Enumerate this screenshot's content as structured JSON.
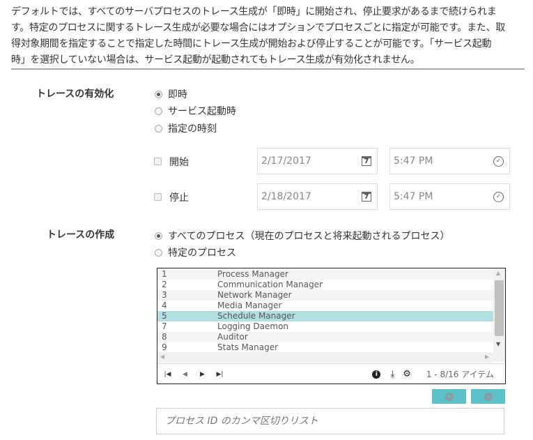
{
  "description_lines": [
    "デフォルトでは、すべてのサーバプロセスのトレース生成が「即時」に開始され、停止要求があるまで続けられま",
    "す。特定のプロセスに関するトレース生成が必要な場合にはオプションでプロセスごとに指定が可能です。また、取",
    "得対象期間を指定することで指定した時間にトレース生成が開始および停止することが可能です。「サービス起動",
    "時」を選択していない場合は、サービス起動が起動されてもトレース生成が有効化されません。"
  ],
  "enable": {
    "label": "トレースの有効化",
    "options": [
      "即時",
      "サービス起動時",
      "指定の時刻"
    ],
    "selected": 0
  },
  "start": {
    "label": "開始",
    "checked": false,
    "date": "2/17/2017",
    "time": "5:47 PM"
  },
  "stop": {
    "label": "停止",
    "checked": false,
    "date": "2/18/2017",
    "time": "5:47 PM"
  },
  "create": {
    "label": "トレースの作成",
    "options": [
      "すべてのプロセス（現在のプロセスと将来起動されるプロセス）",
      "特定のプロセス"
    ],
    "selected": 0
  },
  "grid": {
    "rows": [
      {
        "id": "1",
        "name": "Process Manager"
      },
      {
        "id": "2",
        "name": "Communication Manager"
      },
      {
        "id": "3",
        "name": "Network Manager"
      },
      {
        "id": "4",
        "name": "Media Manager"
      },
      {
        "id": "5",
        "name": "Schedule Manager",
        "selected": true
      },
      {
        "id": "7",
        "name": "Logging Daemon"
      },
      {
        "id": "8",
        "name": "Auditor"
      },
      {
        "id": "9",
        "name": "Stats Manager"
      }
    ],
    "pager_info": "1 - 8/16 アイテム"
  },
  "pid_input": {
    "placeholder": "プロセス ID のカンマ区切りリスト",
    "value": ""
  },
  "colors": {
    "accent": "#5bc0c8",
    "selected_row": "#b2dfe4"
  }
}
